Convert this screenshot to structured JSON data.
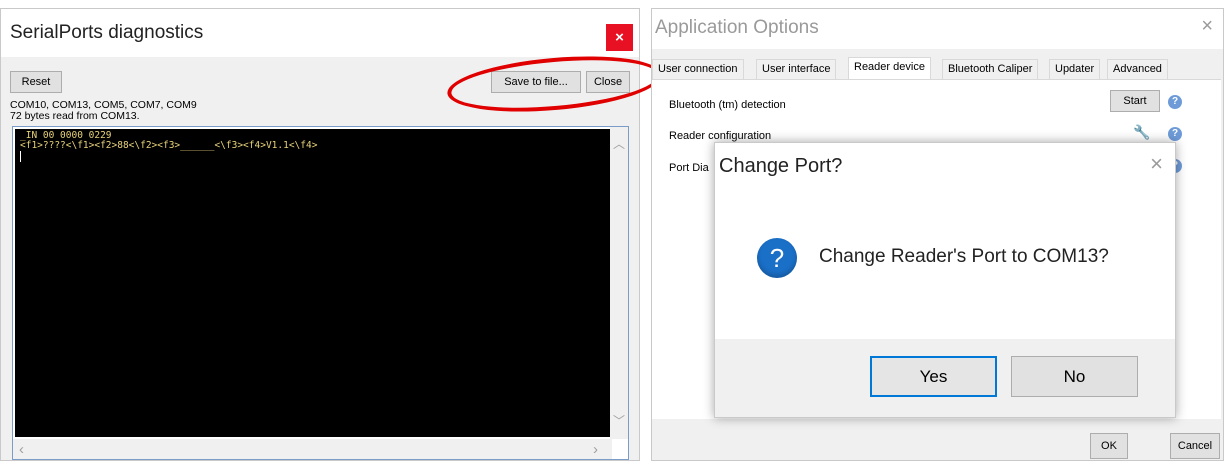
{
  "serial_window": {
    "title": "SerialPorts diagnostics",
    "close_glyph": "×",
    "reset_label": "Reset",
    "save_label": "Save to file...",
    "close_label": "Close",
    "ports_text": "COM10, COM13, COM5, COM7, COM9",
    "bytes_text": "72 bytes read from COM13.",
    "terminal_lines": [
      "_IN 00 0000 0229",
      "<f1>????<\\f1><f2>88<\\f2><f3>______<\\f3><f4>V1.1<\\f4>"
    ],
    "highlight_color": "#e00000"
  },
  "options_window": {
    "title": "Application Options",
    "close_glyph": "×",
    "tabs": [
      {
        "label": "User connection"
      },
      {
        "label": "User interface"
      },
      {
        "label": "Reader device"
      },
      {
        "label": "Bluetooth Caliper"
      },
      {
        "label": "Updater"
      },
      {
        "label": "Advanced"
      }
    ],
    "active_tab": "Reader device",
    "rows": {
      "bluetooth_label": "Bluetooth (tm) detection",
      "start_label": "Start",
      "reader_config_label": "Reader configuration",
      "port_label": "Port Dia"
    },
    "ok_label": "OK",
    "cancel_label": "Cancel"
  },
  "dialog": {
    "title": "Change Port?",
    "close_glyph": "×",
    "icon_glyph": "?",
    "message": "Change Reader's Port to COM13?",
    "yes_label": "Yes",
    "no_label": "No"
  }
}
